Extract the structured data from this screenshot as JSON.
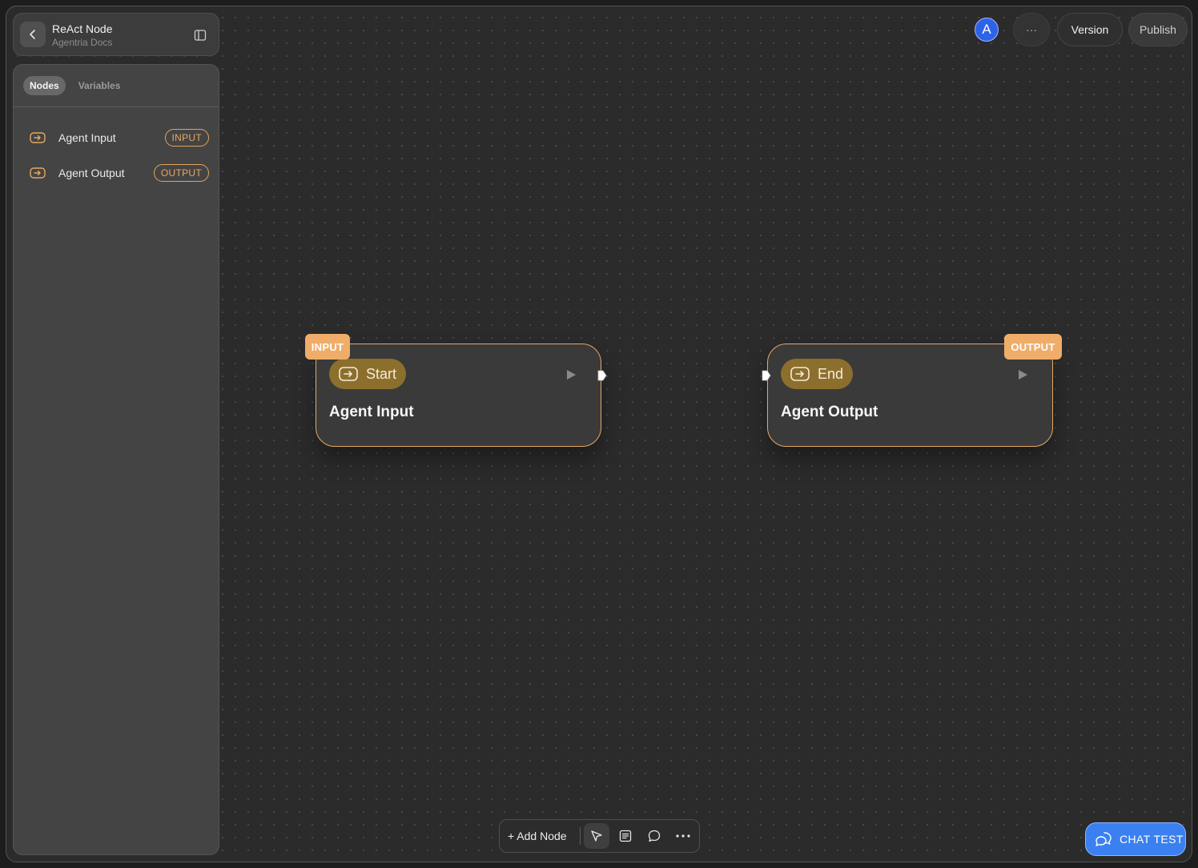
{
  "header": {
    "title": "ReAct Node",
    "subtitle": "Agentria Docs"
  },
  "sidebar": {
    "tabs": [
      {
        "label": "Nodes",
        "active": true
      },
      {
        "label": "Variables",
        "active": false
      }
    ],
    "items": [
      {
        "label": "Agent Input",
        "badge": "INPUT",
        "icon": "arrow-in-box-icon"
      },
      {
        "label": "Agent Output",
        "badge": "OUTPUT",
        "icon": "arrow-in-box-icon"
      }
    ]
  },
  "topbar": {
    "avatar_letter": "A",
    "more_label": "···",
    "version_label": "Version",
    "publish_label": "Publish"
  },
  "canvas": {
    "nodes": [
      {
        "tag": "INPUT",
        "chip": "Start",
        "title": "Agent Input"
      },
      {
        "tag": "OUTPUT",
        "chip": "End",
        "title": "Agent Output"
      }
    ]
  },
  "toolbar": {
    "add_node_label": "+ Add Node"
  },
  "chat_test": {
    "label": "CHAT TEST"
  },
  "colors": {
    "accent_orange": "#e6a862",
    "chip_gold": "#8c6f2d",
    "avatar_blue": "#2f63e7",
    "chat_blue": "#3b80f1"
  }
}
